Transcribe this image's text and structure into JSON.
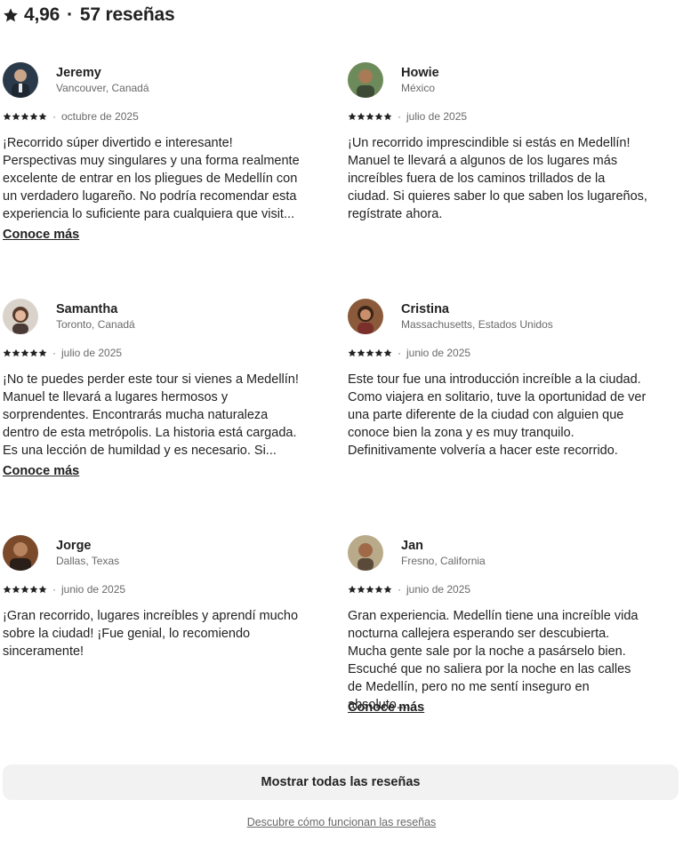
{
  "summary": {
    "rating": "4,96",
    "separator": "·",
    "count_label": "57 reseñas"
  },
  "reviews": [
    {
      "name": "Jeremy",
      "location": "Vancouver, Canadá",
      "stars": 5,
      "date": "octubre de 2025",
      "text": "¡Recorrido súper divertido e interesante! Perspectivas muy singulares y una forma realmente excelente de entrar en los pliegues de Medellín con un verdadero lugareño. No podría recomendar esta experiencia lo suficiente para cualquiera que visit...",
      "more": "Conoce más"
    },
    {
      "name": "Howie",
      "location": "México",
      "stars": 5,
      "date": "julio de 2025",
      "text": "¡Un recorrido imprescindible si estás en Medellín! Manuel te llevará a algunos de los lugares más increíbles fuera de los caminos trillados de la ciudad. Si quieres saber lo que saben los lugareños, regístrate ahora.",
      "more": ""
    },
    {
      "name": "Samantha",
      "location": "Toronto, Canadá",
      "stars": 5,
      "date": "julio de 2025",
      "text": "¡No te puedes perder este tour si vienes a Medellín! Manuel te llevará a lugares hermosos y sorprendentes. Encontrarás mucha naturaleza dentro de esta metrópolis. La historia está cargada. Es una lección de humildad y es necesario. Si...",
      "more": "Conoce más"
    },
    {
      "name": "Cristina",
      "location": "Massachusetts, Estados Unidos",
      "stars": 5,
      "date": "junio de 2025",
      "text": "Este tour fue una introducción increíble a la ciudad. Como viajera en solitario, tuve la oportunidad de ver una parte diferente de la ciudad con alguien que conoce bien la zona y es muy tranquilo. Definitivamente volvería a hacer este recorrido.",
      "more": ""
    },
    {
      "name": "Jorge",
      "location": "Dallas, Texas",
      "stars": 5,
      "date": "junio de 2025",
      "text": "¡Gran recorrido, lugares increíbles y aprendí mucho sobre la ciudad! ¡Fue genial, lo recomiendo sinceramente!",
      "more": ""
    },
    {
      "name": "Jan",
      "location": "Fresno, California",
      "stars": 5,
      "date": "junio de 2025",
      "text": "Gran experiencia. Medellín tiene una increíble vida nocturna callejera esperando ser descubierta. Mucha gente sale por la noche a pasárselo bien. Escuché que no saliera por la noche en las calles de Medellín, pero no me sentí inseguro en absoluto....",
      "more": "Conoce más"
    }
  ],
  "actions": {
    "show_all": "Mostrar todas las reseñas",
    "learn_link": "Descubre cómo funcionan las reseñas"
  },
  "icons": {
    "rating": "star-icon",
    "review_stars": "star-icon"
  },
  "colors": {
    "text": "#222222",
    "muted": "#6a6a6a",
    "button_bg": "#f2f2f2"
  }
}
